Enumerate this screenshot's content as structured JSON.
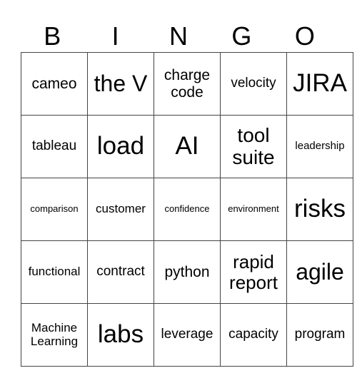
{
  "header": [
    "B",
    "I",
    "N",
    "G",
    "O"
  ],
  "rows": [
    [
      "cameo",
      "the V",
      "charge code",
      "velocity",
      "JIRA"
    ],
    [
      "tableau",
      "load",
      "AI",
      "tool suite",
      "leadership"
    ],
    [
      "comparison",
      "customer",
      "confidence",
      "environment",
      "risks"
    ],
    [
      "functional",
      "contract",
      "python",
      "rapid report",
      "agile"
    ],
    [
      "Machine Learning",
      "labs",
      "leverage",
      "capacity",
      "program"
    ]
  ]
}
